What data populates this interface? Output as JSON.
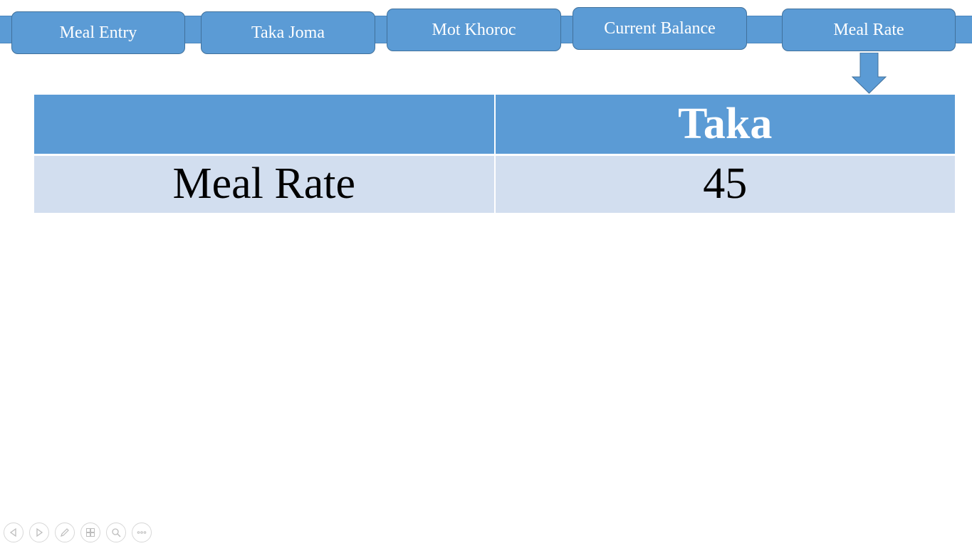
{
  "nav": {
    "items": [
      {
        "label": "Meal Entry"
      },
      {
        "label": "Taka Joma"
      },
      {
        "label": "Mot Khoroc"
      },
      {
        "label": "Current Balance"
      },
      {
        "label": "Meal Rate"
      }
    ],
    "active_item": "Meal Rate"
  },
  "table": {
    "headers": [
      "",
      "Taka"
    ],
    "rows": [
      {
        "label": "Meal Rate",
        "value": "45"
      }
    ]
  },
  "controls": {
    "icons": [
      "previous-icon",
      "next-icon",
      "pen-icon",
      "slides-icon",
      "zoom-icon",
      "more-icon"
    ]
  },
  "colors": {
    "accent": "#5b9bd5",
    "button_border": "#41719c",
    "row_fill": "#d2deef",
    "text_on_accent": "#ffffff"
  }
}
